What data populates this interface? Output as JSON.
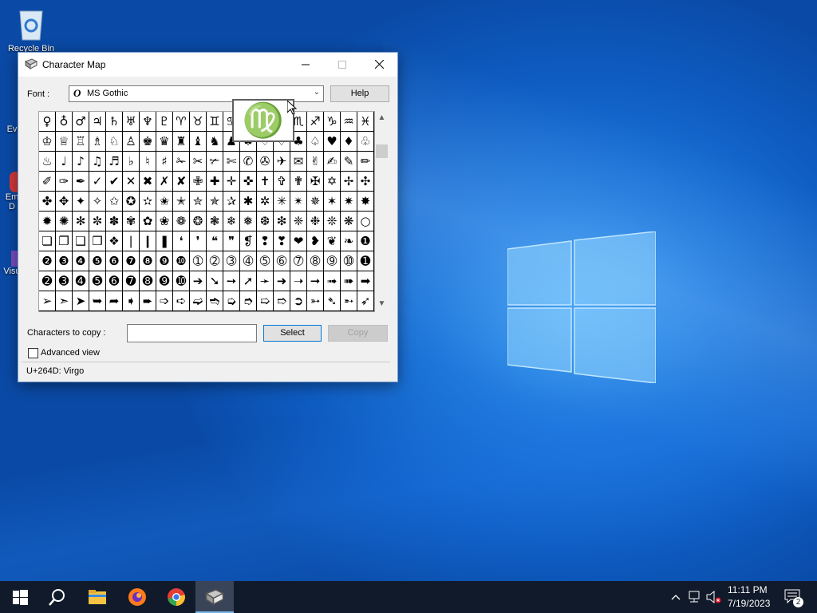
{
  "desktop": {
    "icons": [
      {
        "label": "Recycle Bin"
      },
      {
        "label": "Ev"
      },
      {
        "label": "Em\nD"
      },
      {
        "label": "Visu"
      }
    ]
  },
  "charmap": {
    "title": "Character Map",
    "font_label": "Font :",
    "font_value": "MS Gothic",
    "help_label": "Help",
    "magnified_char": "♍",
    "chars": [
      "♀",
      "♁",
      "♂",
      "♃",
      "♄",
      "♅",
      "♆",
      "♇",
      "♈",
      "♉",
      "♊",
      "♋",
      "♌",
      "♍",
      "♎",
      "♏",
      "♐",
      "♑",
      "♒",
      "♓",
      "♔",
      "♕",
      "♖",
      "♗",
      "♘",
      "♙",
      "♚",
      "♛",
      "♜",
      "♝",
      "♞",
      "♟",
      "♠",
      "♡",
      "♢",
      "♣",
      "♤",
      "♥",
      "♦",
      "♧",
      "♨",
      "♩",
      "♪",
      "♫",
      "♬",
      "♭",
      "♮",
      "♯",
      "✁",
      "✂",
      "✃",
      "✄",
      "✆",
      "✇",
      "✈",
      "✉",
      "✌",
      "✍",
      "✎",
      "✏",
      "✐",
      "✑",
      "✒",
      "✓",
      "✔",
      "✕",
      "✖",
      "✗",
      "✘",
      "✙",
      "✚",
      "✛",
      "✜",
      "✝",
      "✞",
      "✟",
      "✠",
      "✡",
      "✢",
      "✣",
      "✤",
      "✥",
      "✦",
      "✧",
      "✩",
      "✪",
      "✫",
      "✬",
      "✭",
      "✮",
      "✯",
      "✰",
      "✱",
      "✲",
      "✳",
      "✴",
      "✵",
      "✶",
      "✷",
      "✸",
      "✹",
      "✺",
      "✻",
      "✼",
      "✽",
      "✾",
      "✿",
      "❀",
      "❁",
      "❂",
      "❃",
      "❄",
      "❅",
      "❆",
      "❇",
      "❈",
      "❉",
      "❊",
      "❋",
      "○",
      "❏",
      "❐",
      "❑",
      "❒",
      "❖",
      "❘",
      "❙",
      "❚",
      "❛",
      "❜",
      "❝",
      "❞",
      "❡",
      "❢",
      "❣",
      "❤",
      "❥",
      "❦",
      "❧",
      "❶",
      "❷",
      "❸",
      "❹",
      "❺",
      "❻",
      "❼",
      "❽",
      "❾",
      "❿",
      "➀",
      "➁",
      "➂",
      "➃",
      "➄",
      "➅",
      "➆",
      "➇",
      "➈",
      "➉",
      "➊",
      "➋",
      "➌",
      "➍",
      "➎",
      "➏",
      "➐",
      "➑",
      "➒",
      "➓",
      "➔",
      "➘",
      "➙",
      "➚",
      "➛",
      "➜",
      "➝",
      "➞",
      "➟",
      "➠",
      "➡",
      "➢",
      "➣",
      "➤",
      "➥",
      "➦",
      "➧",
      "➨",
      "➩",
      "➪",
      "➫",
      "➬",
      "➭",
      "➮",
      "➯",
      "➱",
      "➲",
      "➳",
      "➴",
      "➵",
      "➶"
    ],
    "copy_label": "Characters to copy :",
    "copy_value": "",
    "select_label": "Select",
    "copy_button": "Copy",
    "advanced_label": "Advanced view",
    "status": "U+264D: Virgo"
  },
  "taskbar": {
    "time": "11:11 PM",
    "date": "7/19/2023",
    "notifications": "2"
  },
  "colors": {
    "accent": "#0078d7",
    "taskbar": "#101a2a"
  }
}
